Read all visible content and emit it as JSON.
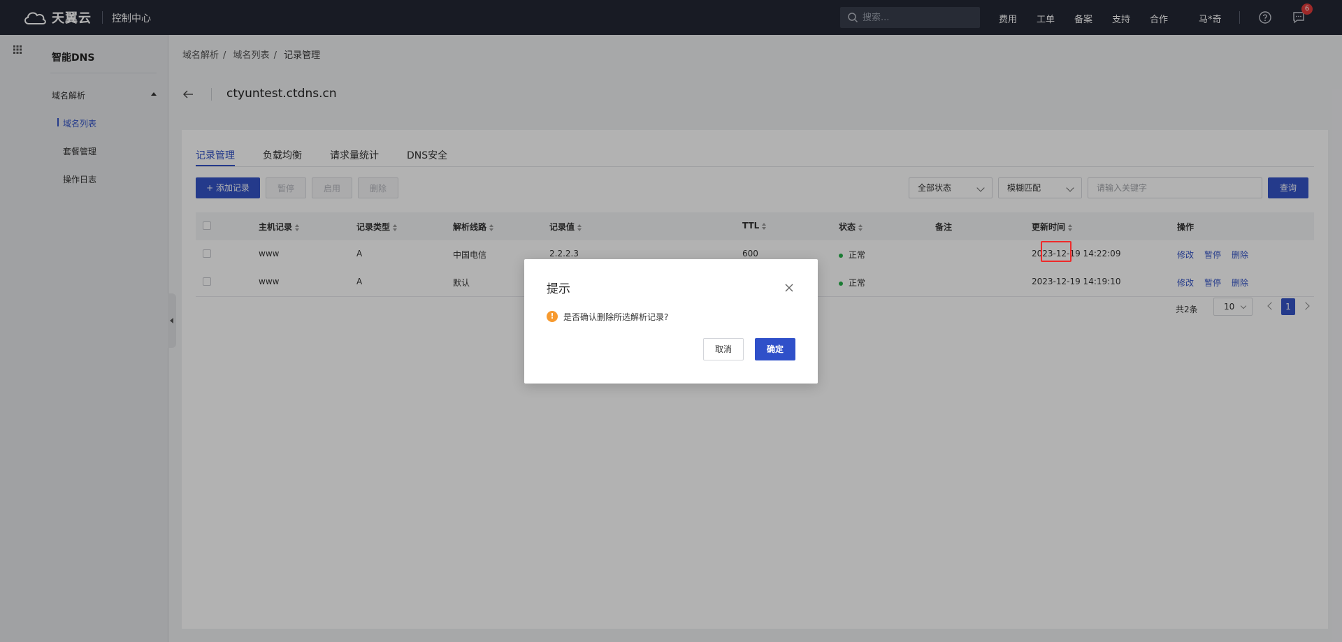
{
  "topbar": {
    "brand": "天翼云",
    "console": "控制中心",
    "search_placeholder": "搜索...",
    "nav": [
      "费用",
      "工单",
      "备案",
      "支持",
      "合作"
    ],
    "user": "马*奇",
    "message_count": "6"
  },
  "sidebar": {
    "title": "智能DNS",
    "group": "域名解析",
    "items": [
      {
        "label": "域名列表",
        "active": true
      },
      {
        "label": "套餐管理",
        "active": false
      },
      {
        "label": "操作日志",
        "active": false
      }
    ]
  },
  "breadcrumb": [
    "域名解析",
    "域名列表",
    "记录管理"
  ],
  "breadcrumb_sep": "/",
  "page": {
    "domain": "ctyuntest.ctdns.cn"
  },
  "tabs": [
    "记录管理",
    "负载均衡",
    "请求量统计",
    "DNS安全"
  ],
  "toolbar": {
    "add": "+ 添加记录",
    "pause": "暂停",
    "enable": "启用",
    "delete": "删除",
    "status_filter": "全部状态",
    "match_mode": "模糊匹配",
    "keyword_placeholder": "请输入关键字",
    "query": "查询"
  },
  "table": {
    "columns": [
      "主机记录",
      "记录类型",
      "解析线路",
      "记录值",
      "TTL",
      "状态",
      "备注",
      "更新时间",
      "操作"
    ],
    "rows": [
      {
        "host": "www",
        "type": "A",
        "line": "中国电信",
        "value": "2.2.2.3",
        "ttl": "600",
        "status": "正常",
        "note": "",
        "updated": "2023-12-19 14:22:09",
        "actions": [
          "修改",
          "暂停",
          "删除"
        ]
      },
      {
        "host": "www",
        "type": "A",
        "line": "默认",
        "value": "",
        "ttl": "",
        "status": "正常",
        "note": "",
        "updated": "2023-12-19 14:19:10",
        "actions": [
          "修改",
          "暂停",
          "删除"
        ]
      }
    ]
  },
  "pagination": {
    "total": "共2条",
    "page_size": "10",
    "current": "1"
  },
  "dialog": {
    "title": "提示",
    "message": "是否确认删除所选解析记录?",
    "cancel": "取消",
    "confirm": "确定"
  },
  "colors": {
    "primary": "#3454c7",
    "topbar": "#232734",
    "status_ok": "#26b14a",
    "warn": "#f79a2f",
    "highlight": "#ee2a2a"
  }
}
